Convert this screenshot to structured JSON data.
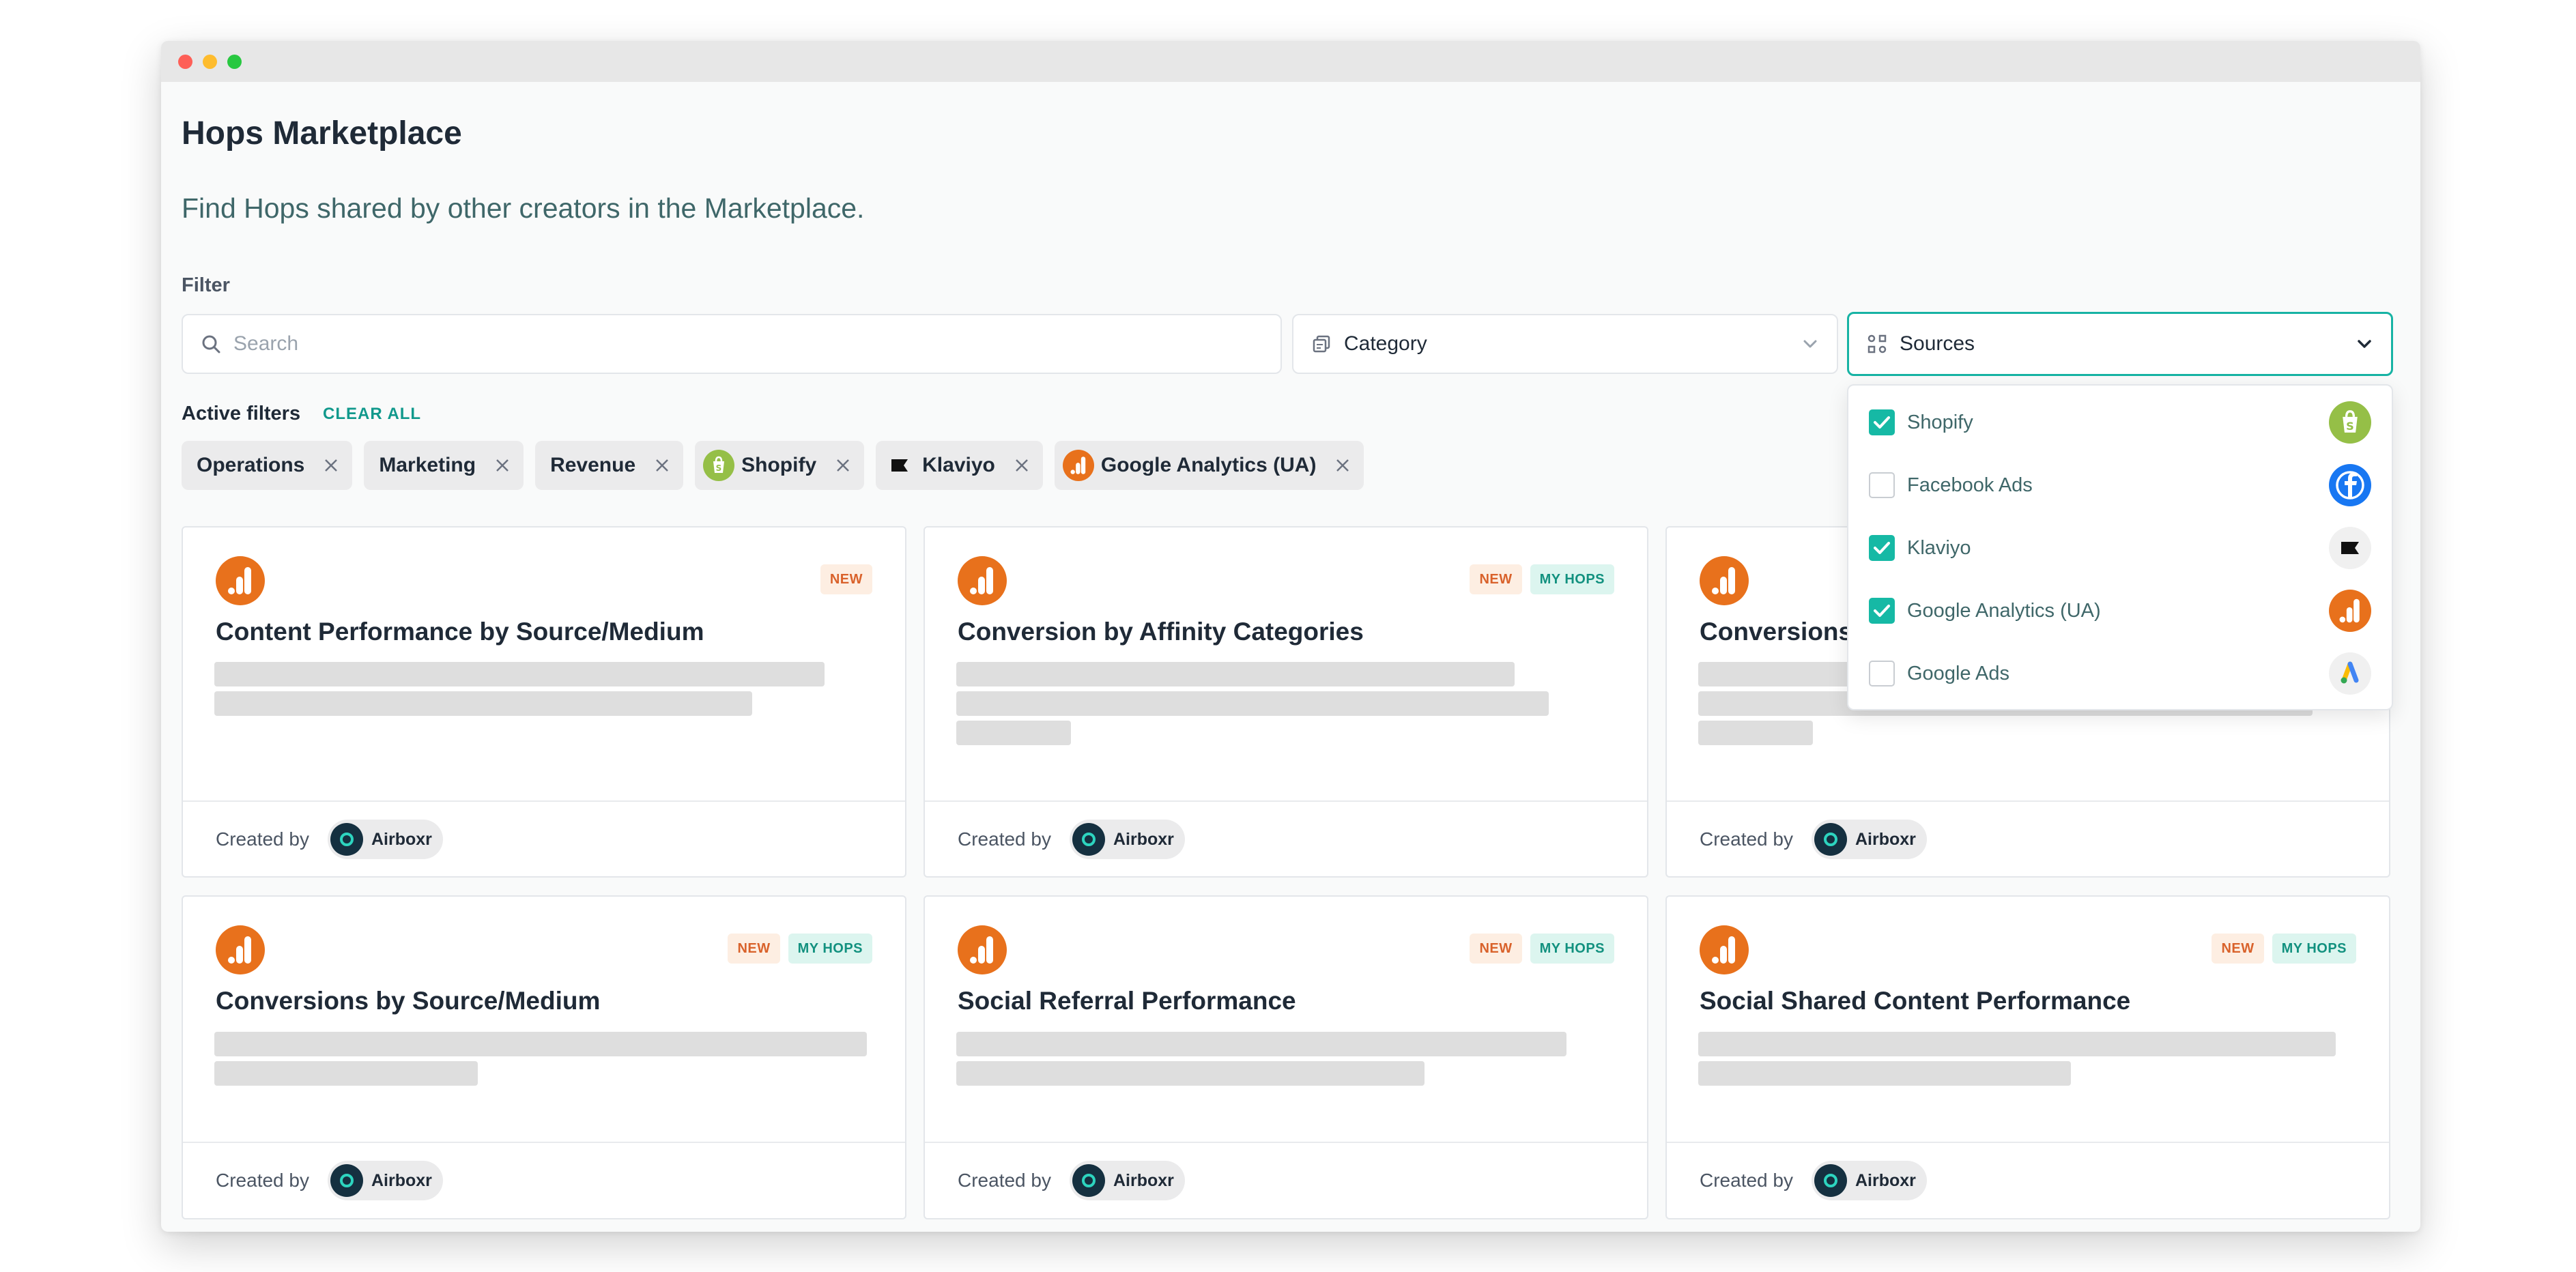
{
  "page": {
    "title": "Hops Marketplace",
    "subtitle": "Find Hops shared by other creators in the Marketplace."
  },
  "filter": {
    "label": "Filter",
    "search_placeholder": "Search",
    "category_label": "Category",
    "sources_label": "Sources"
  },
  "active_filters": {
    "label": "Active filters",
    "clear_all": "CLEAR ALL",
    "chips": [
      {
        "label": "Operations",
        "icon": ""
      },
      {
        "label": "Marketing",
        "icon": ""
      },
      {
        "label": "Revenue",
        "icon": ""
      },
      {
        "label": "Shopify",
        "icon": "shopify-icon"
      },
      {
        "label": "Klaviyo",
        "icon": "klaviyo-icon"
      },
      {
        "label": "Google Analytics (UA)",
        "icon": "google-analytics-icon"
      }
    ]
  },
  "sources_dropdown": {
    "options": [
      {
        "label": "Shopify",
        "checked": true,
        "icon": "shopify-icon"
      },
      {
        "label": "Facebook Ads",
        "checked": false,
        "icon": "facebook-icon"
      },
      {
        "label": "Klaviyo",
        "checked": true,
        "icon": "klaviyo-icon"
      },
      {
        "label": "Google Analytics (UA)",
        "checked": true,
        "icon": "google-analytics-icon"
      },
      {
        "label": "Google Ads",
        "checked": false,
        "icon": "google-ads-icon"
      }
    ]
  },
  "cards": [
    {
      "title": "Content Performance by Source/Medium",
      "badges": [
        "NEW"
      ],
      "created_by": "Created by",
      "author": "Airboxr"
    },
    {
      "title": "Conversion by Affinity Categories",
      "badges": [
        "NEW",
        "MY HOPS"
      ],
      "created_by": "Created by",
      "author": "Airboxr"
    },
    {
      "title": "Conversions",
      "badges": [],
      "created_by": "Created by",
      "author": "Airboxr"
    },
    {
      "title": "Conversions by Source/Medium",
      "badges": [
        "NEW",
        "MY HOPS"
      ],
      "created_by": "Created by",
      "author": "Airboxr"
    },
    {
      "title": "Social Referral Performance",
      "badges": [
        "NEW",
        "MY HOPS"
      ],
      "created_by": "Created by",
      "author": "Airboxr"
    },
    {
      "title": "Social Shared Content Performance",
      "badges": [
        "NEW",
        "MY HOPS"
      ],
      "created_by": "Created by",
      "author": "Airboxr"
    }
  ],
  "colors": {
    "accent": "#17b3a4",
    "ga_orange": "#e8711c",
    "badge_new": "#d9622b",
    "badge_myhops": "#12917f"
  }
}
